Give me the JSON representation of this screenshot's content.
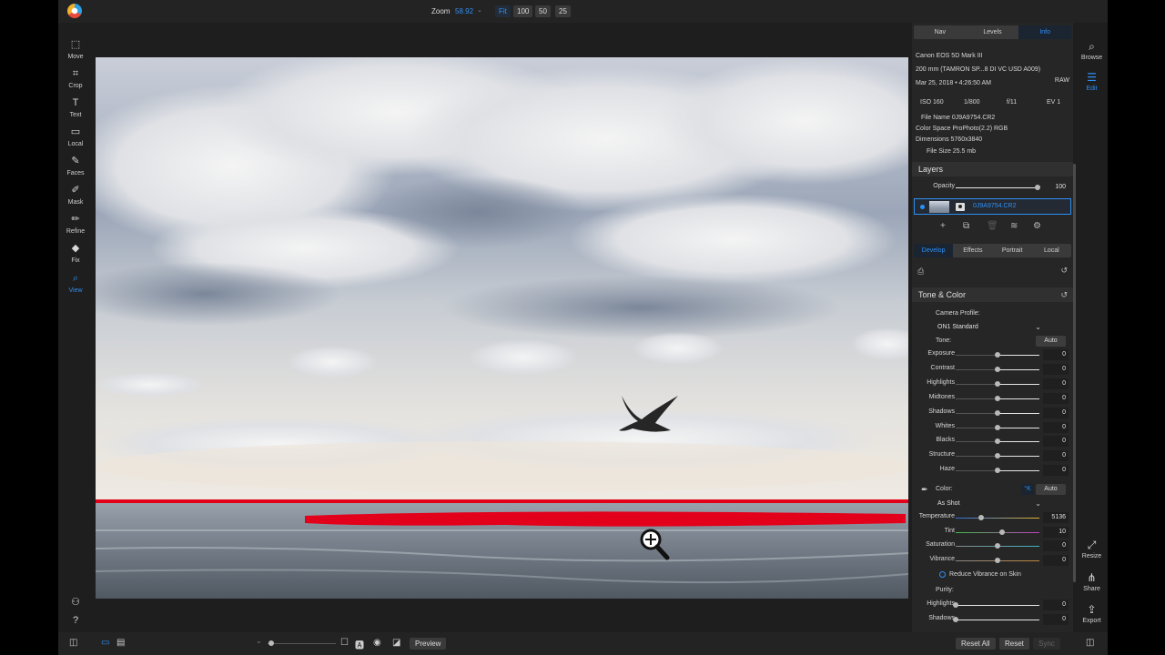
{
  "topbar": {
    "zoom_label": "Zoom",
    "zoom_value": "58.92",
    "zoom_presets": [
      "Fit",
      "100",
      "50",
      "25"
    ],
    "active_preset": "Fit"
  },
  "left_tools": [
    {
      "label": "Move",
      "icon": "move-icon"
    },
    {
      "label": "Crop",
      "icon": "crop-icon"
    },
    {
      "label": "Text",
      "icon": "text-icon"
    },
    {
      "label": "Local",
      "icon": "local-icon"
    },
    {
      "label": "Faces",
      "icon": "faces-icon"
    },
    {
      "label": "Mask",
      "icon": "mask-icon"
    },
    {
      "label": "Refine",
      "icon": "refine-icon"
    },
    {
      "label": "Fix",
      "icon": "fix-icon"
    },
    {
      "label": "View",
      "icon": "view-icon",
      "active": true
    }
  ],
  "right_tools": {
    "browse": "Browse",
    "edit": "Edit",
    "resize": "Resize",
    "share": "Share",
    "export": "Export"
  },
  "info_tabs": [
    "Nav",
    "Levels",
    "Info"
  ],
  "info": {
    "camera": "Canon EOS 5D Mark III",
    "lens": "200 mm (TAMRON SP...8 DI VC USD A009)",
    "date": "Mar 25, 2018 • 4:26:50 AM",
    "raw": "RAW",
    "iso": "ISO 160",
    "shutter": "1/800",
    "aperture": "f/11",
    "ev": "EV 1",
    "file_name": "File Name 0J9A9754.CR2",
    "color_space": "Color Space ProPhoto(2.2) RGB",
    "dimensions": "Dimensions 5760x3840",
    "file_size": "File Size 25.5 mb"
  },
  "layers": {
    "title": "Layers",
    "opacity_label": "Opacity",
    "opacity_value": "100",
    "layer_name": "0J9A9754.CR2"
  },
  "develop_tabs": [
    "Develop",
    "Effects",
    "Portrait",
    "Local"
  ],
  "tone_color": {
    "title": "Tone & Color",
    "camera_profile_label": "Camera Profile:",
    "camera_profile_value": "ON1 Standard",
    "tone_label": "Tone:",
    "auto_label": "Auto",
    "sliders": [
      {
        "label": "Exposure",
        "value": "0",
        "pos": 0.5
      },
      {
        "label": "Contrast",
        "value": "0",
        "pos": 0.5
      },
      {
        "label": "Highlights",
        "value": "0",
        "pos": 0.5
      },
      {
        "label": "Midtones",
        "value": "0",
        "pos": 0.5
      },
      {
        "label": "Shadows",
        "value": "0",
        "pos": 0.5
      },
      {
        "label": "Whites",
        "value": "0",
        "pos": 0.5
      },
      {
        "label": "Blacks",
        "value": "0",
        "pos": 0.5
      },
      {
        "label": "Structure",
        "value": "0",
        "pos": 0.5
      },
      {
        "label": "Haze",
        "value": "0",
        "pos": 0.5
      }
    ],
    "color_label": "Color:",
    "k_label": "°K",
    "color_auto": "Auto",
    "color_preset": "As Shot",
    "color_sliders": [
      {
        "label": "Temperature",
        "value": "5136",
        "pos": 0.3
      },
      {
        "label": "Tint",
        "value": "10",
        "pos": 0.55
      },
      {
        "label": "Saturation",
        "value": "0",
        "pos": 0.5
      },
      {
        "label": "Vibrance",
        "value": "0",
        "pos": 0.5
      }
    ],
    "reduce_vibrance": "Reduce Vibrance on Skin",
    "purity_label": "Purity:",
    "purity_sliders": [
      {
        "label": "Highlights",
        "value": "0",
        "pos": 0.0
      },
      {
        "label": "Shadows",
        "value": "0",
        "pos": 0.0
      }
    ]
  },
  "bottombar": {
    "preview": "Preview",
    "reset_all": "Reset All",
    "reset": "Reset",
    "sync": "Sync"
  }
}
